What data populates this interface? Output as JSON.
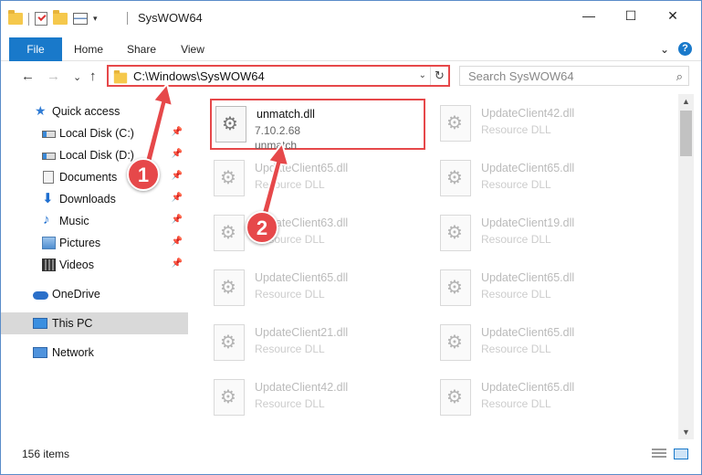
{
  "window": {
    "title": "SysWOW64",
    "controls": {
      "minimize": "—",
      "maximize": "☐",
      "close": "✕"
    }
  },
  "ribbon": {
    "tabs": [
      "File",
      "Home",
      "Share",
      "View"
    ],
    "expand_glyph": "⌄",
    "help_glyph": "?"
  },
  "nav": {
    "back": "←",
    "forward": "→",
    "recent": "⌄",
    "up": "↑",
    "address": "C:\\Windows\\SysWOW64",
    "address_drop": "⌄",
    "refresh": "↻",
    "search_placeholder": "Search SysWOW64",
    "search_glyph": "⌕"
  },
  "sidebar": {
    "items": [
      {
        "label": "Quick access"
      },
      {
        "label": "Local Disk (C:)"
      },
      {
        "label": "Local Disk (D:)"
      },
      {
        "label": "Documents"
      },
      {
        "label": "Downloads"
      },
      {
        "label": "Music"
      },
      {
        "label": "Pictures"
      },
      {
        "label": "Videos"
      },
      {
        "label": "OneDrive"
      },
      {
        "label": "This PC"
      },
      {
        "label": "Network"
      }
    ],
    "pin_glyph": "📌"
  },
  "files": {
    "highlighted": {
      "name": "unmatch.dll",
      "version": "7.10.2.68",
      "description": "unmatch"
    },
    "tiles": [
      {
        "name": "UpdateClient42.dll",
        "desc": "Resource DLL"
      },
      {
        "name": "UpdateClient65.dll",
        "desc": "Resource DLL"
      },
      {
        "name": "UpdateClient65.dll",
        "desc": "Resource DLL"
      },
      {
        "name": "UpdateClient63.dll",
        "desc": "Resource DLL"
      },
      {
        "name": "UpdateClient19.dll",
        "desc": "Resource DLL"
      },
      {
        "name": "UpdateClient65.dll",
        "desc": "Resource DLL"
      },
      {
        "name": "UpdateClient65.dll",
        "desc": "Resource DLL"
      },
      {
        "name": "UpdateClient21.dll",
        "desc": "Resource DLL"
      },
      {
        "name": "UpdateClient65.dll",
        "desc": "Resource DLL"
      },
      {
        "name": "UpdateClient42.dll",
        "desc": "Resource DLL"
      },
      {
        "name": "UpdateClient65.dll",
        "desc": "Resource DLL"
      }
    ]
  },
  "status": {
    "count": "156 items"
  },
  "annotations": {
    "step1": "1",
    "step2": "2",
    "color": "#e6484a"
  }
}
